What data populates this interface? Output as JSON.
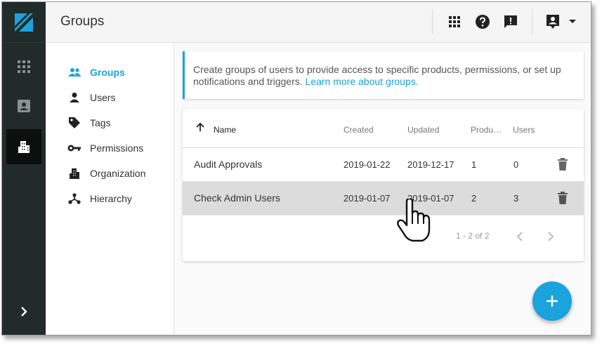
{
  "header": {
    "title": "Groups",
    "icons": [
      "apps-grid-icon",
      "help-icon",
      "feedback-icon",
      "account-icon",
      "chevron-down-icon"
    ]
  },
  "rail": {
    "items": [
      "apps-icon",
      "contact-card-icon",
      "organization-icon"
    ],
    "active": "organization-icon"
  },
  "subnav": {
    "items": [
      {
        "label": "Groups",
        "icon": "people-icon",
        "active": true
      },
      {
        "label": "Users",
        "icon": "person-icon"
      },
      {
        "label": "Tags",
        "icon": "tag-icon"
      },
      {
        "label": "Permissions",
        "icon": "key-icon"
      },
      {
        "label": "Organization",
        "icon": "building-icon"
      },
      {
        "label": "Hierarchy",
        "icon": "hierarchy-icon"
      }
    ]
  },
  "info": {
    "text": "Create groups of users to provide access to specific products, permissions, or set up notifications and triggers.",
    "link": "Learn more about groups."
  },
  "table": {
    "columns": [
      "Name",
      "Created",
      "Updated",
      "Produ…",
      "Users"
    ],
    "rows": [
      {
        "name": "Audit Approvals",
        "created": "2019-01-22",
        "updated": "2019-12-17",
        "products": "1",
        "users": "0"
      },
      {
        "name": "Check Admin Users",
        "created": "2019-01-07",
        "updated": "2019-01-07",
        "products": "2",
        "users": "3"
      }
    ],
    "pagination": "1 - 2 of 2"
  },
  "colors": {
    "accent": "#1aa3dd",
    "rail": "#212b29",
    "row_hover": "#dcdcdc"
  }
}
